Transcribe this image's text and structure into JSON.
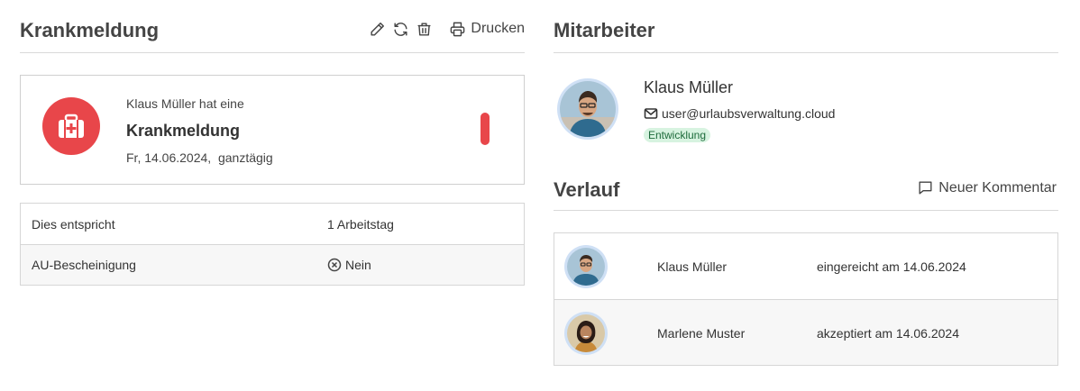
{
  "left_header": {
    "title": "Krankmeldung",
    "print_label": "Drucken",
    "icons": [
      "pencil-icon",
      "refresh-icon",
      "trash-icon",
      "printer-icon"
    ]
  },
  "sick_note": {
    "intro": "Klaus Müller hat eine",
    "title": "Krankmeldung",
    "date": "Fr, 14.06.2024,  ganztägig",
    "icon": "medical-kit-icon",
    "status_color": "#e8464a"
  },
  "details": [
    {
      "label": "Dies entspricht",
      "value": "1 Arbeitstag"
    },
    {
      "label": "AU-Bescheinigung",
      "value": "Nein"
    }
  ],
  "employee_section": {
    "title": "Mitarbeiter",
    "name": "Klaus Müller",
    "email": "user@urlaubsverwaltung.cloud",
    "department": "Entwicklung"
  },
  "history_section": {
    "title": "Verlauf",
    "comment_label": "Neuer Kommentar",
    "entries": [
      {
        "name": "Klaus Müller",
        "action": "eingereicht am 14.06.2024"
      },
      {
        "name": "Marlene Muster",
        "action": "akzeptiert am 14.06.2024"
      }
    ]
  },
  "colors": {
    "accent_red": "#e8464a",
    "badge_green_bg": "#d7f3e0",
    "badge_green_text": "#1d6b3b",
    "avatar_ring": "#cfe0f5"
  }
}
